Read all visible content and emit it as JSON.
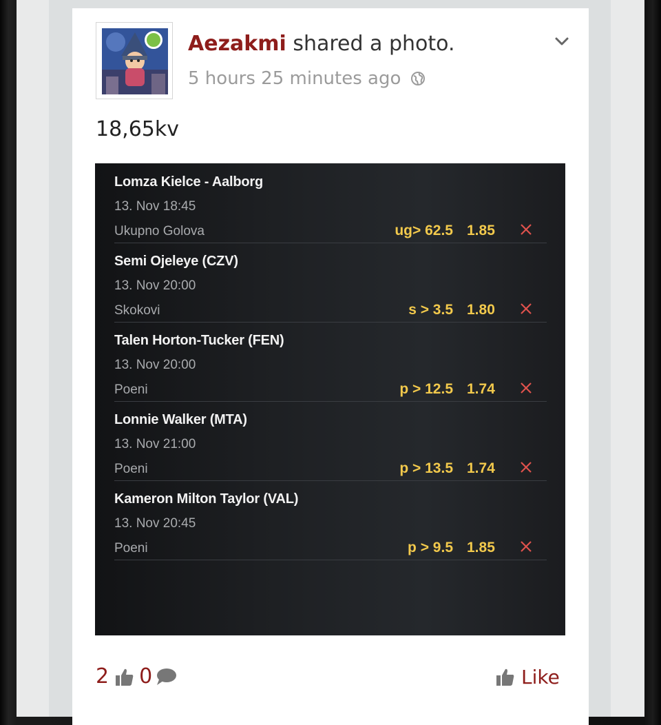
{
  "post": {
    "author": "Aezakmi",
    "action": "shared a photo.",
    "timestamp": "5 hours 25 minutes ago",
    "text": "18,65kv"
  },
  "ticket": {
    "bets": [
      {
        "title": "Lomza Kielce - Aalborg",
        "date": "13. Nov 18:45",
        "market": "Ukupno Golova",
        "pick": "ug> 62.5",
        "odds": "1.85"
      },
      {
        "title": "Semi Ojeleye (CZV)",
        "date": "13. Nov 20:00",
        "market": "Skokovi",
        "pick": "s > 3.5",
        "odds": "1.80"
      },
      {
        "title": "Talen Horton-Tucker (FEN)",
        "date": "13. Nov 20:00",
        "market": "Poeni",
        "pick": "p > 12.5",
        "odds": "1.74"
      },
      {
        "title": "Lonnie Walker (MTA)",
        "date": "13. Nov 21:00",
        "market": "Poeni",
        "pick": "p > 13.5",
        "odds": "1.74"
      },
      {
        "title": "Kameron Milton  Taylor (VAL)",
        "date": "13. Nov 20:45",
        "market": "Poeni",
        "pick": "p > 9.5",
        "odds": "1.85"
      }
    ]
  },
  "footer": {
    "likes_count": "2",
    "comments_count": "0",
    "like_label": "Like"
  },
  "icons": {
    "online": "online-status-dot",
    "privacy": "globe-icon",
    "menu": "chevron-down-icon",
    "likes": "thumbs-up-icon",
    "comments": "speech-bubble-icon",
    "remove": "close-x-icon"
  },
  "colors": {
    "accent": "#8e1d1b",
    "odds": "#f2c94c",
    "remove": "#e0524d",
    "online": "#7cc046"
  }
}
